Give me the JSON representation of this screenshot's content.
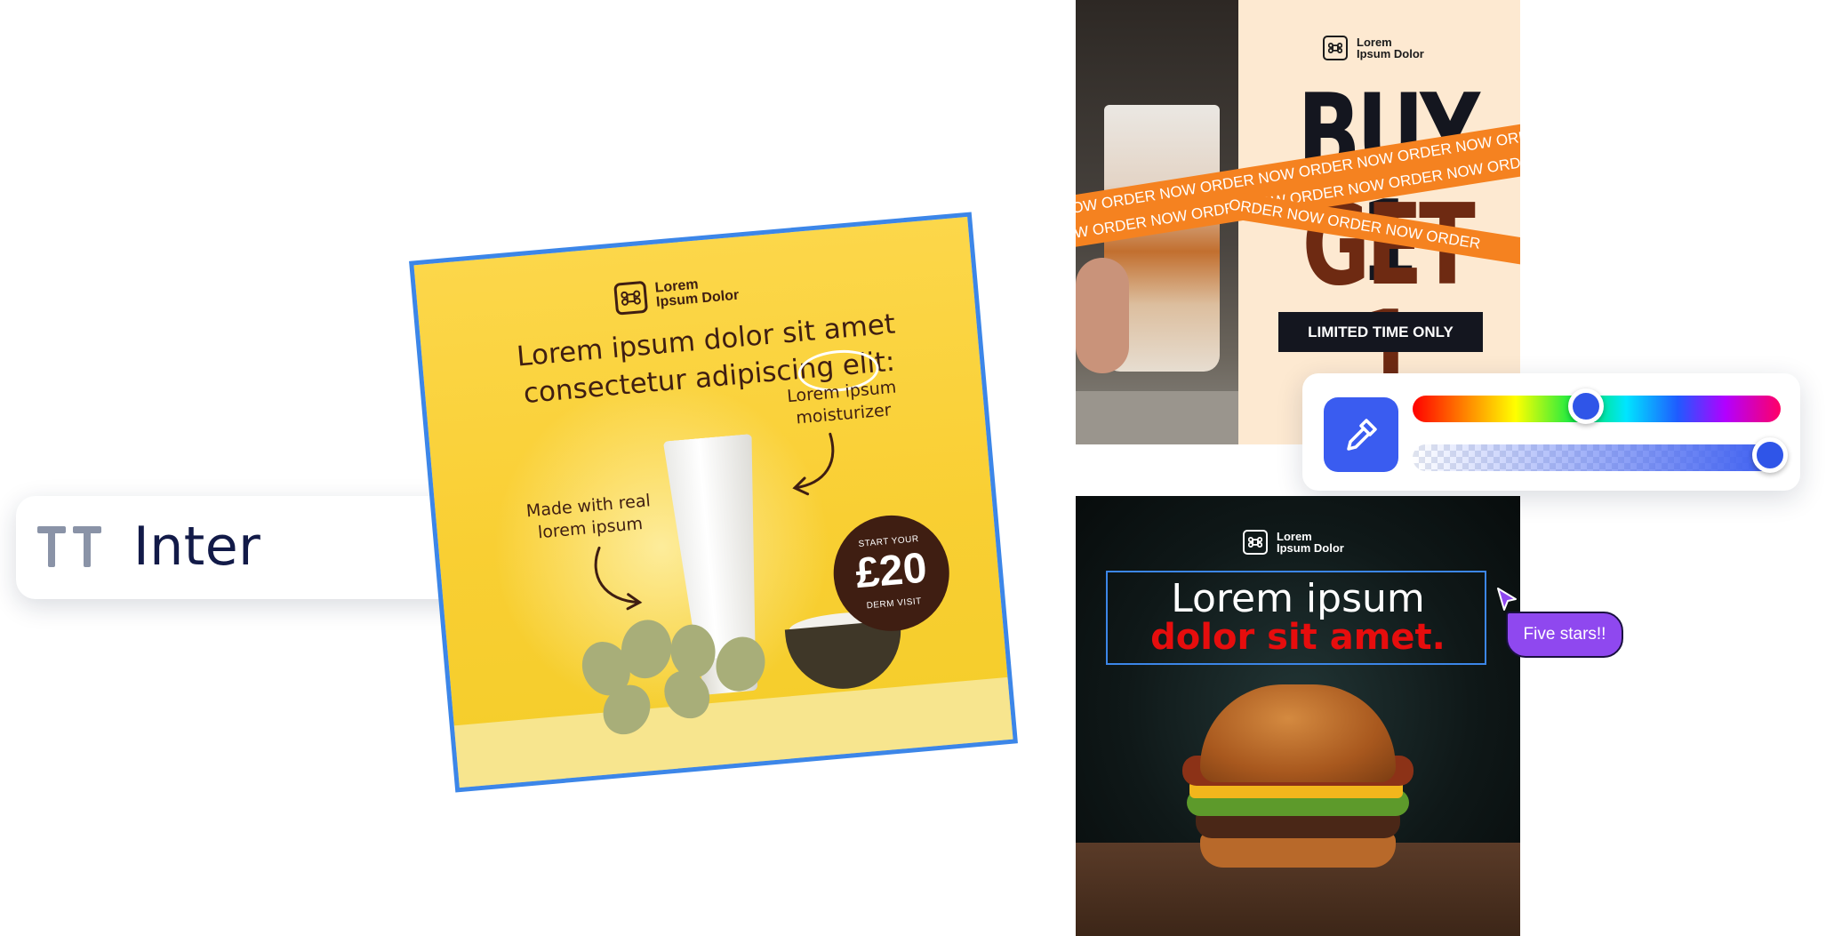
{
  "font_picker": {
    "font_icon": "font-tt-icon",
    "font_name": "Inter",
    "selected_icon": "checkmark-icon"
  },
  "skin_ad": {
    "brand_icon": "command-key-icon",
    "brand_line1": "Lorem",
    "brand_line2": "Ipsum Dolor",
    "headline_line1": "Lorem ipsum dolor sit amet",
    "headline_line2": "consectetur adipiscing elit:",
    "note_left_line1": "Made with real",
    "note_left_line2": "lorem ipsum",
    "note_right_line1": "Lorem ipsum",
    "note_right_line2": "moisturizer",
    "badge_top": "START YOUR",
    "badge_price": "£20",
    "badge_bottom": "DERM VISIT",
    "selection_color": "#3c86e8"
  },
  "bogo_ad": {
    "brand_line1": "Lorem",
    "brand_line2": "Ipsum Dolor",
    "headline_line1": "BUY 1",
    "headline_line2": "GET 1",
    "tape_text": "NOW ORDER NOW ORDER NOW ORDER NOW ORDER NOW ORDER NOW ORDER NOW",
    "tape_text_short": "ORDER NOW ORDER NOW ORDER",
    "cta": "LIMITED TIME ONLY",
    "tape_color": "#f58220"
  },
  "color_picker": {
    "tool_icon": "eyedropper-icon",
    "accent_color": "#3a5cf0",
    "hue_level": 0.47,
    "alpha_level": 0.97
  },
  "burger_ad": {
    "brand_line1": "Lorem",
    "brand_line2": "Ipsum Dolor",
    "headline_line1": "Lorem ipsum",
    "headline_line2": "dolor sit amet.",
    "headline_accent": "#e60d0d"
  },
  "collaboration": {
    "cursor_icon": "pointer-cursor-icon",
    "comment": "Five stars!!",
    "comment_color": "#8f48ef"
  }
}
